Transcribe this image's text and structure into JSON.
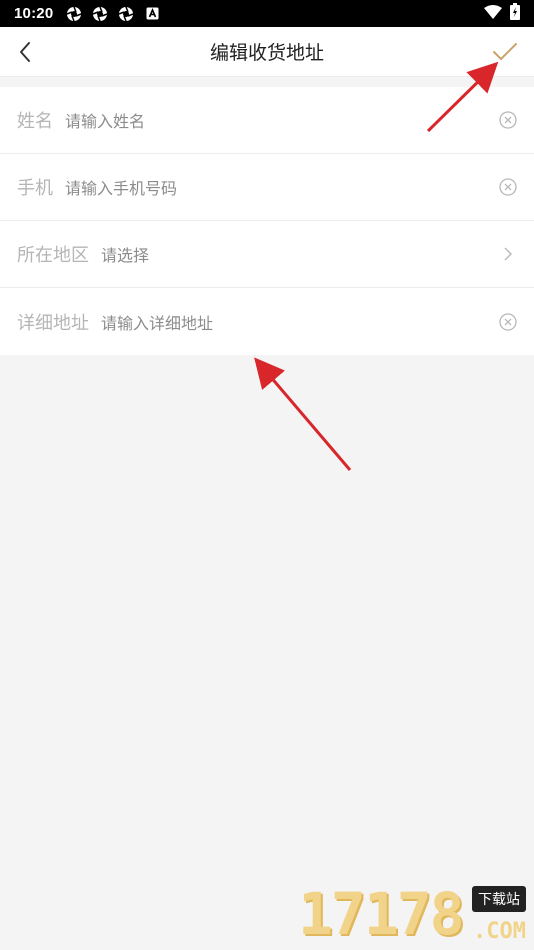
{
  "status_bar": {
    "time": "10:20",
    "icons": [
      "aperture-icon",
      "aperture-icon",
      "aperture-icon",
      "a-badge-icon"
    ],
    "right_icons": [
      "wifi-icon",
      "battery-charging-icon"
    ]
  },
  "nav": {
    "title": "编辑收货地址",
    "back_icon": "chevron-left-icon",
    "confirm_icon": "checkmark-icon",
    "confirm_color": "#c9a36a"
  },
  "form": {
    "rows": [
      {
        "label": "姓名",
        "placeholder": "请输入姓名",
        "action_icon": "clear-circle-icon"
      },
      {
        "label": "手机",
        "placeholder": "请输入手机号码",
        "action_icon": "clear-circle-icon"
      },
      {
        "label": "所在地区",
        "placeholder": "请选择",
        "action_icon": "chevron-right-icon"
      },
      {
        "label": "详细地址",
        "placeholder": "请输入详细地址",
        "action_icon": "clear-circle-icon"
      }
    ]
  },
  "annotations": {
    "arrow_color": "#d9262a"
  },
  "watermark": {
    "digits": "17178",
    "badge": "下载站",
    "suffix": ".COM"
  }
}
